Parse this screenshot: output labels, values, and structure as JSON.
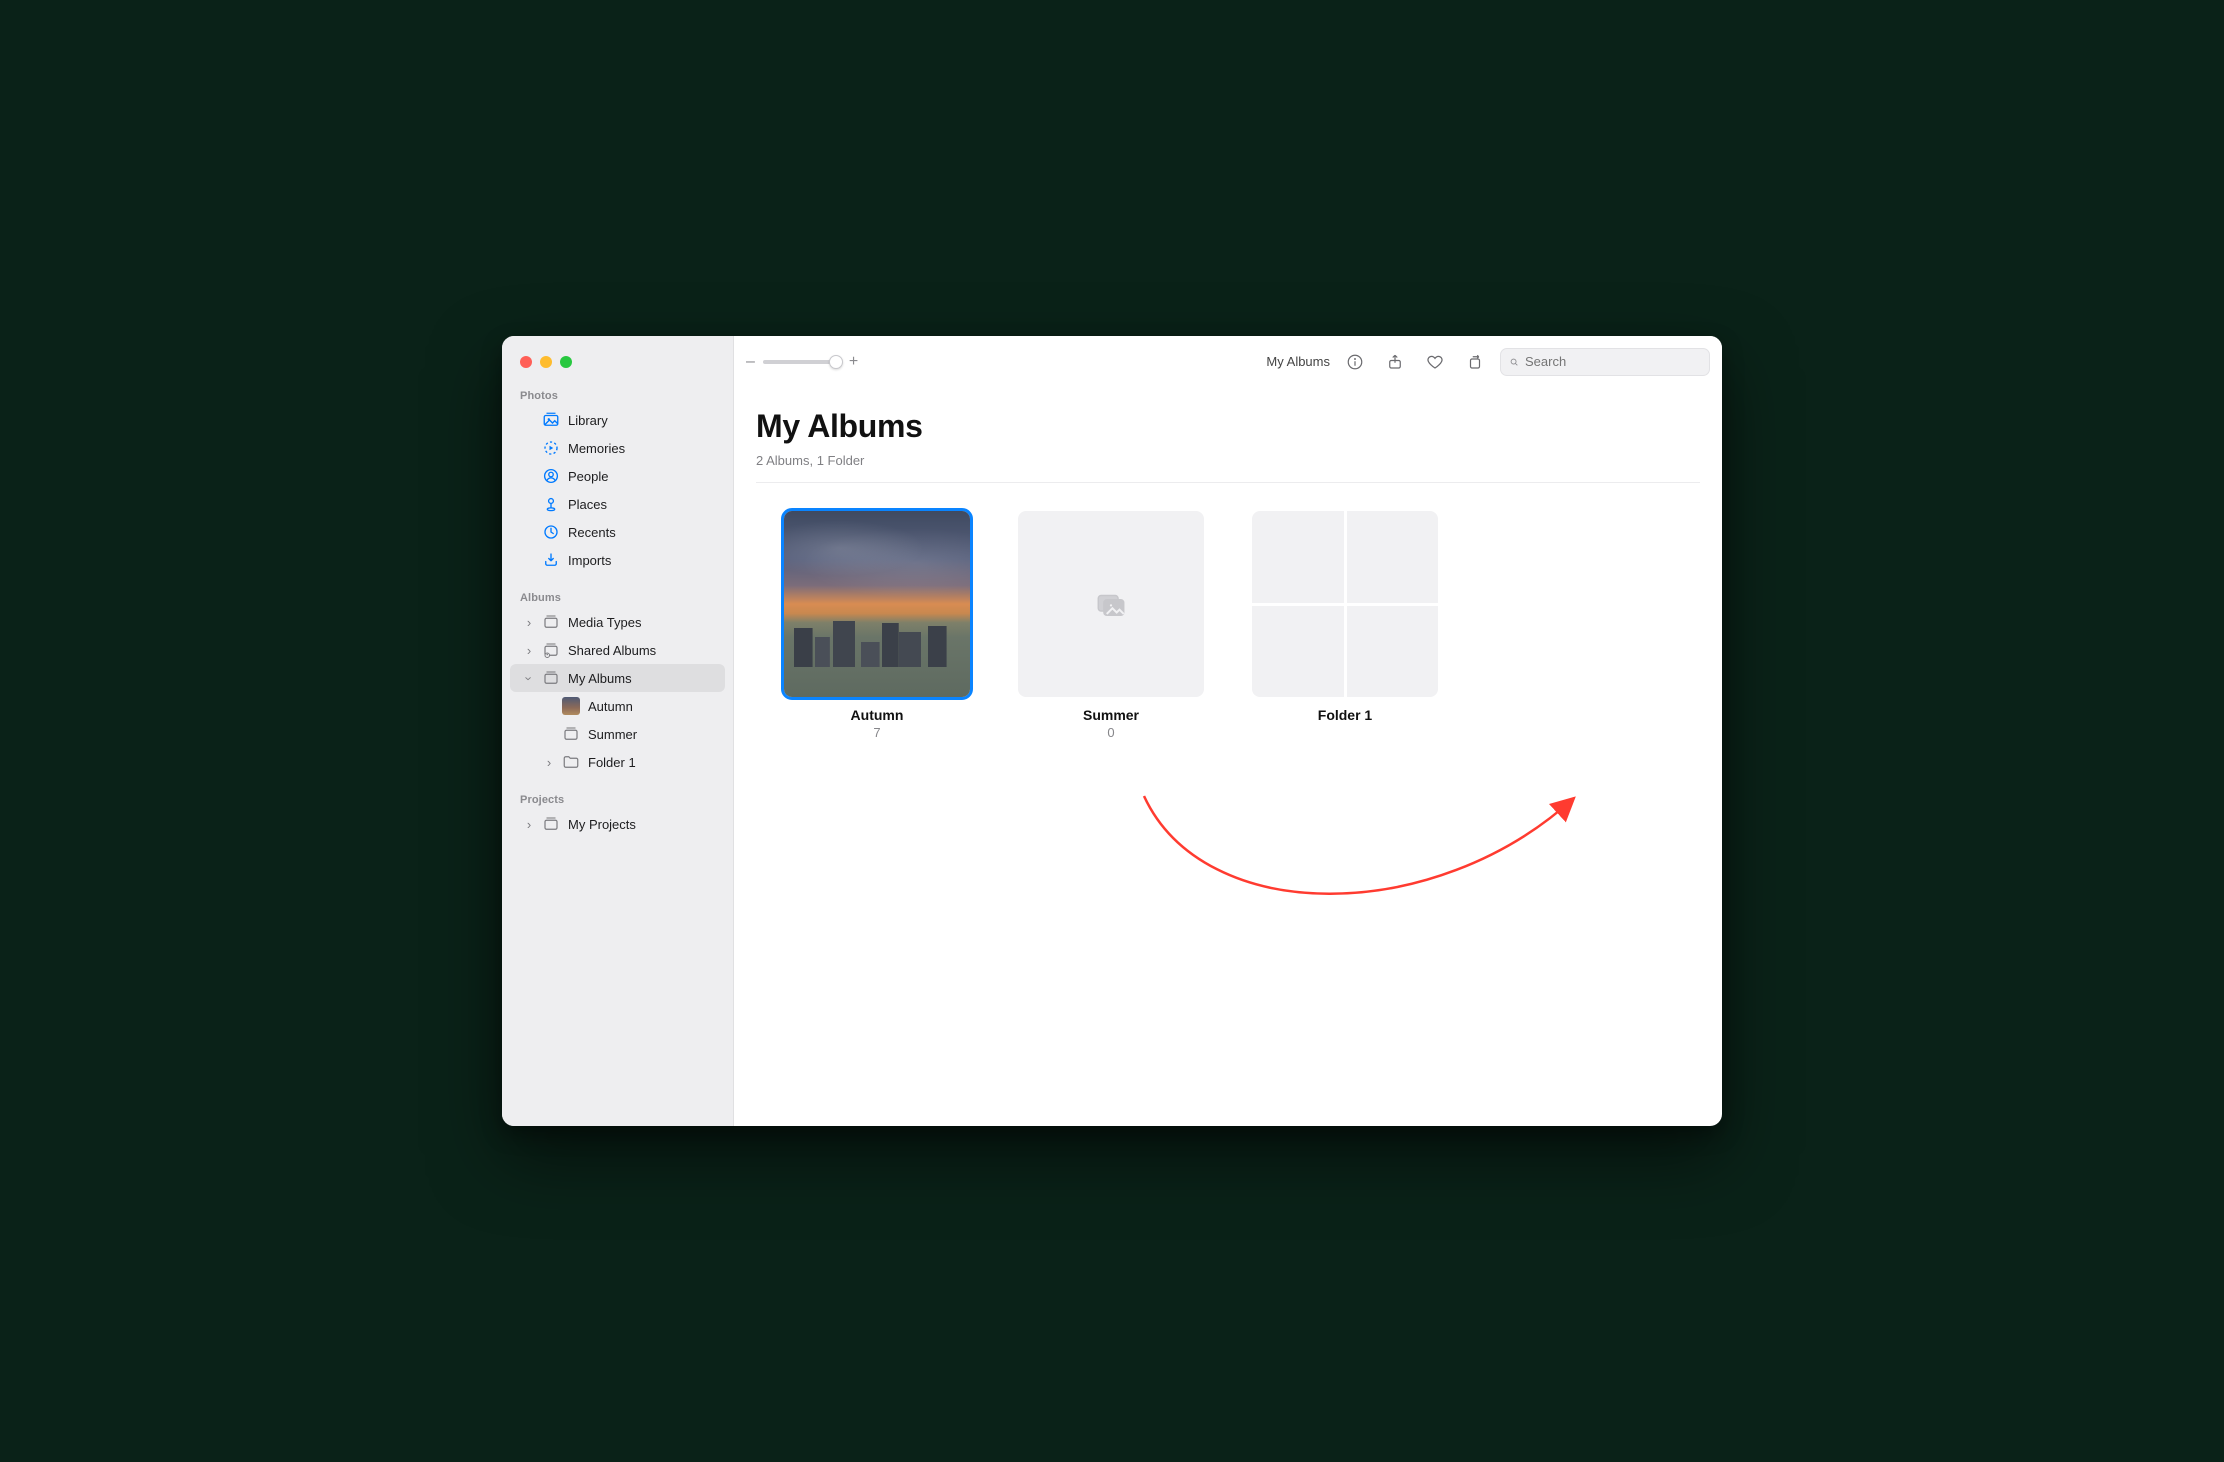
{
  "sidebar": {
    "groups": {
      "photos": {
        "label": "Photos",
        "items": [
          {
            "label": "Library"
          },
          {
            "label": "Memories"
          },
          {
            "label": "People"
          },
          {
            "label": "Places"
          },
          {
            "label": "Recents"
          },
          {
            "label": "Imports"
          }
        ]
      },
      "albums": {
        "label": "Albums",
        "media_types_label": "Media Types",
        "shared_albums_label": "Shared Albums",
        "my_albums": {
          "label": "My Albums",
          "children": [
            {
              "label": "Autumn"
            },
            {
              "label": "Summer"
            },
            {
              "label": "Folder 1"
            }
          ]
        }
      },
      "projects": {
        "label": "Projects",
        "my_projects_label": "My Projects"
      }
    }
  },
  "toolbar": {
    "zoom_minus": "–",
    "zoom_plus": "+",
    "title": "My Albums",
    "search_placeholder": "Search"
  },
  "page": {
    "title": "My Albums",
    "subtitle": "2 Albums, 1 Folder"
  },
  "grid": {
    "items": [
      {
        "title": "Autumn",
        "count": "7"
      },
      {
        "title": "Summer",
        "count": "0"
      },
      {
        "title": "Folder 1",
        "count": ""
      }
    ]
  }
}
